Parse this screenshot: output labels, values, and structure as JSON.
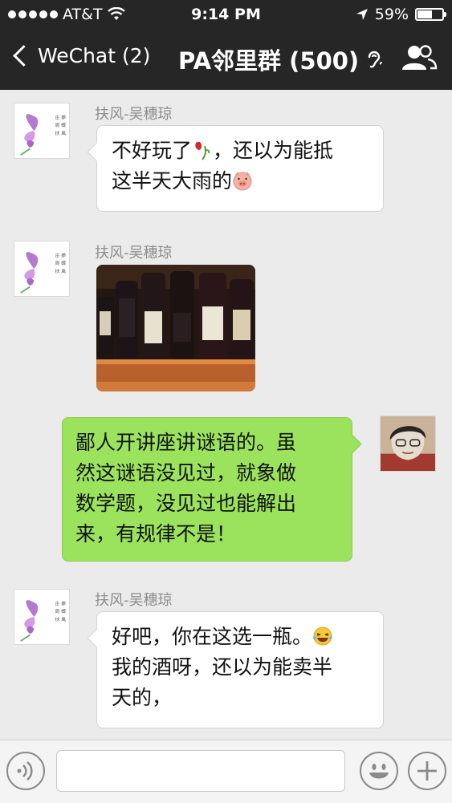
{
  "status": {
    "carrier": "AT&T",
    "time": "9:14 PM",
    "battery": "59%",
    "battery_level": 0.59
  },
  "nav": {
    "back_label": "WeChat (2)",
    "title": "PA邻里群 (500)"
  },
  "messages": [
    {
      "sender": "扶风-吴穗琼",
      "lines": [
        "不好玩了",
        "，还以为能抵",
        "这半天大雨的"
      ]
    },
    {
      "sender": "扶风-吴穗琼"
    },
    {
      "lines": [
        "鄙人开讲座讲谜语的。虽",
        "然这谜语没见过，就象做",
        "数学题，没见过也能解出",
        "来，有规律不是！"
      ]
    },
    {
      "sender": "扶风-吴穗琼",
      "lines": [
        "好吧，你在这选一瓶。",
        "我的酒呀，还以为能卖半",
        "天的，"
      ]
    }
  ],
  "icons": {
    "back": "chevron-left-icon",
    "ear": "earpiece-icon",
    "people": "group-members-icon",
    "voice": "voice-input-icon",
    "emoji_btn": "emoji-icon",
    "plus": "plus-icon",
    "wilted_rose": "wilted-rose-emoji-icon",
    "pig": "pig-face-emoji-icon",
    "laugh": "tears-of-joy-emoji-icon"
  },
  "colors": {
    "nav_bg": "#262626",
    "chat_bg": "#ebebeb",
    "own_bubble": "#9ce35d",
    "other_bubble": "#ffffff"
  }
}
